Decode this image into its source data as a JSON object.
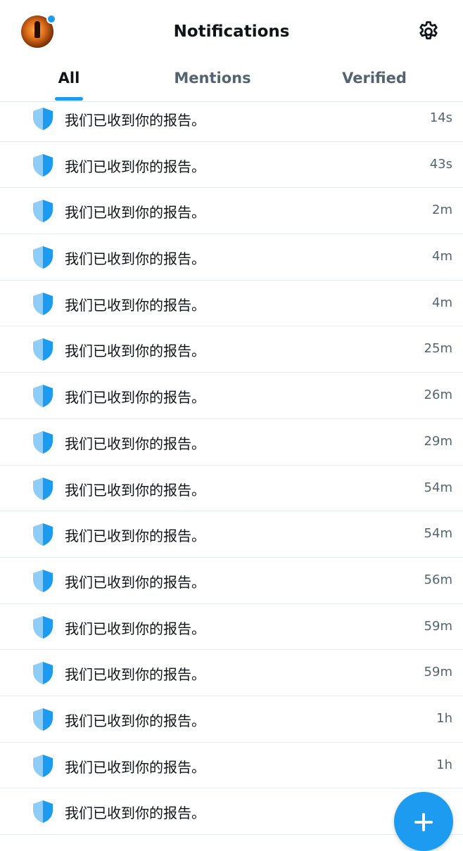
{
  "header": {
    "title": "Notifications",
    "avatar_icon": "profile-avatar",
    "settings_icon": "gear-icon"
  },
  "tabs": [
    {
      "label": "All",
      "active": true
    },
    {
      "label": "Mentions",
      "active": false
    },
    {
      "label": "Verified",
      "active": false
    }
  ],
  "notifications": [
    {
      "icon": "shield-icon",
      "text": "我们已收到你的报告。",
      "time": "14s"
    },
    {
      "icon": "shield-icon",
      "text": "我们已收到你的报告。",
      "time": "43s"
    },
    {
      "icon": "shield-icon",
      "text": "我们已收到你的报告。",
      "time": "2m"
    },
    {
      "icon": "shield-icon",
      "text": "我们已收到你的报告。",
      "time": "4m"
    },
    {
      "icon": "shield-icon",
      "text": "我们已收到你的报告。",
      "time": "4m"
    },
    {
      "icon": "shield-icon",
      "text": "我们已收到你的报告。",
      "time": "25m"
    },
    {
      "icon": "shield-icon",
      "text": "我们已收到你的报告。",
      "time": "26m"
    },
    {
      "icon": "shield-icon",
      "text": "我们已收到你的报告。",
      "time": "29m"
    },
    {
      "icon": "shield-icon",
      "text": "我们已收到你的报告。",
      "time": "54m"
    },
    {
      "icon": "shield-icon",
      "text": "我们已收到你的报告。",
      "time": "54m"
    },
    {
      "icon": "shield-icon",
      "text": "我们已收到你的报告。",
      "time": "56m"
    },
    {
      "icon": "shield-icon",
      "text": "我们已收到你的报告。",
      "time": "59m"
    },
    {
      "icon": "shield-icon",
      "text": "我们已收到你的报告。",
      "time": "59m"
    },
    {
      "icon": "shield-icon",
      "text": "我们已收到你的报告。",
      "time": "1h"
    },
    {
      "icon": "shield-icon",
      "text": "我们已收到你的报告。",
      "time": "1h"
    },
    {
      "icon": "shield-icon",
      "text": "我们已收到你的报告。",
      "time": ""
    }
  ],
  "fab": {
    "icon": "plus-icon"
  },
  "colors": {
    "accent": "#1d9bf0",
    "text_primary": "#0f1419",
    "text_secondary": "#536471",
    "shield_light": "#8ecdf8",
    "shield_dark": "#1d9bf0"
  }
}
